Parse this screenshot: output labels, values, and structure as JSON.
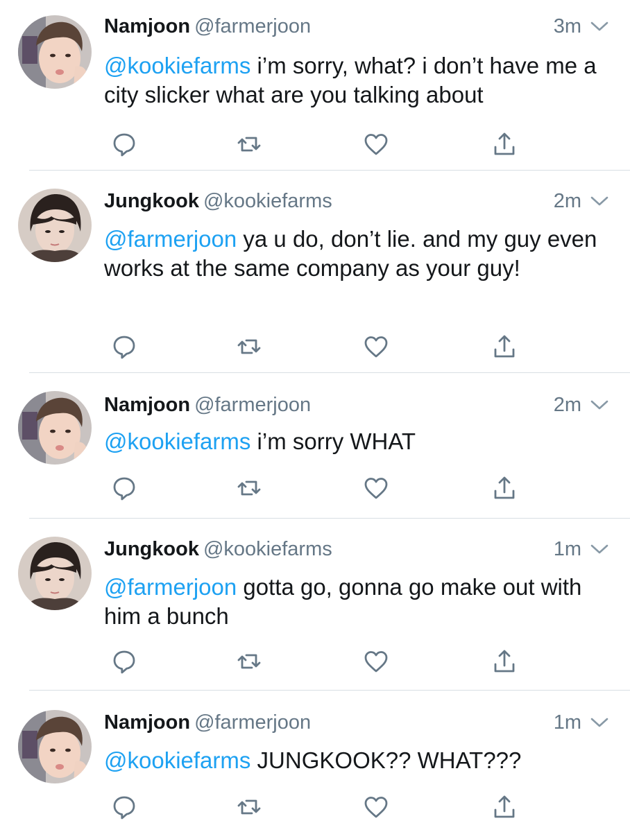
{
  "tweets": [
    {
      "author": "Namjoon",
      "handle": "@farmerjoon",
      "time": "3m",
      "mention": "@kookiefarms",
      "text": " i’m sorry, what? i don’t have me a city slicker what are you talking about"
    },
    {
      "author": "Jungkook",
      "handle": "@kookiefarms",
      "time": "2m",
      "mention": "@farmerjoon",
      "text": " ya u do, don’t lie. and my guy even works at the same company as your guy!"
    },
    {
      "author": "Namjoon",
      "handle": "@farmerjoon",
      "time": "2m",
      "mention": "@kookiefarms",
      "text": " i’m sorry WHAT"
    },
    {
      "author": "Jungkook",
      "handle": "@kookiefarms",
      "time": "1m",
      "mention": "@farmerjoon",
      "text": " gotta go, gonna go make out with him a bunch"
    },
    {
      "author": "Namjoon",
      "handle": "@farmerjoon",
      "time": "1m",
      "mention": "@kookiefarms",
      "text": " JUNGKOOK?? WHAT???"
    }
  ],
  "icons": {
    "reply": "reply-icon",
    "retweet": "retweet-icon",
    "like": "heart-icon",
    "share": "share-icon",
    "more": "chevron-down-icon"
  },
  "colors": {
    "mention": "#1da1f2",
    "secondary_text": "#657786",
    "icon": "#657786",
    "divider": "#d8dee3"
  }
}
